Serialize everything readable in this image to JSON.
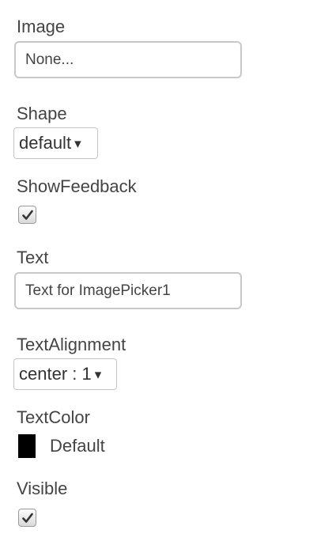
{
  "properties": {
    "image": {
      "label": "Image",
      "value": "None..."
    },
    "shape": {
      "label": "Shape",
      "value": "default",
      "arrow": "▾"
    },
    "show_feedback": {
      "label": "ShowFeedback",
      "checked": true,
      "icon": "checkmark-icon"
    },
    "text": {
      "label": "Text",
      "value": "Text for ImagePicker1"
    },
    "text_alignment": {
      "label": "TextAlignment",
      "value": "center : 1",
      "arrow": "▾"
    },
    "text_color": {
      "label": "TextColor",
      "value": "Default",
      "swatch_color": "#000000"
    },
    "visible": {
      "label": "Visible",
      "checked": true,
      "icon": "checkmark-icon"
    }
  }
}
